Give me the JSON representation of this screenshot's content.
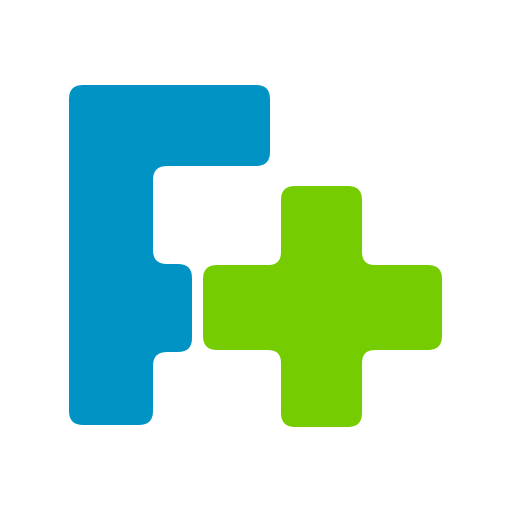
{
  "logo": {
    "name": "f-plus-logo",
    "letter_glyph": "F",
    "symbol_glyph": "+",
    "colors": {
      "letter": "#0093c4",
      "plus": "#75cc00",
      "background": "#ffffff"
    }
  }
}
